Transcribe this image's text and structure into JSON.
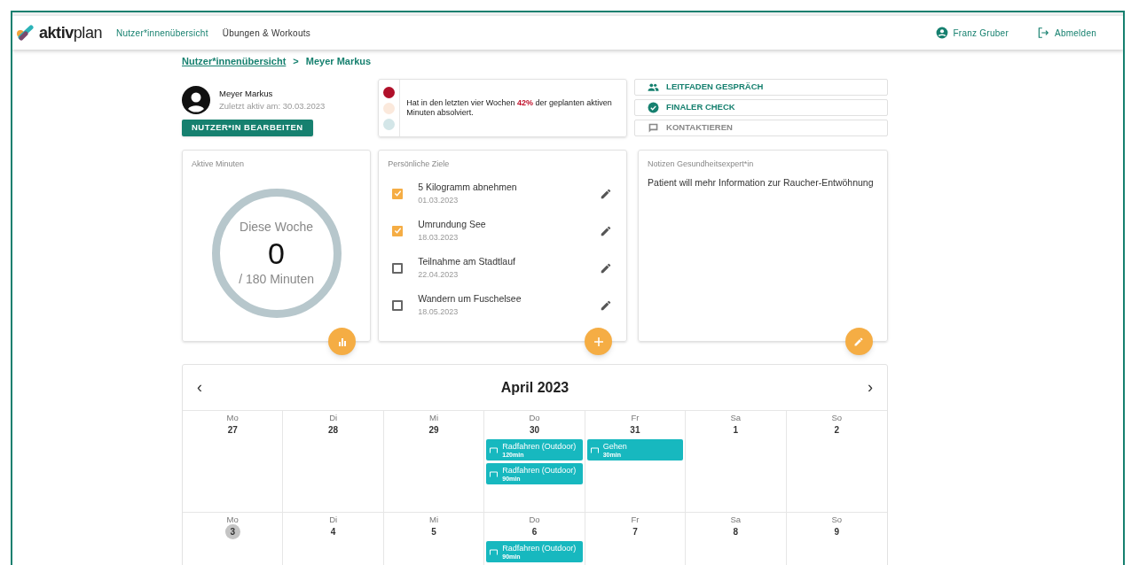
{
  "nav": {
    "logo_bold": "aktiv",
    "logo_rest": "plan",
    "links": [
      {
        "label": "Nutzer*innenübersicht",
        "selected": true
      },
      {
        "label": "Übungen & Workouts",
        "selected": false
      }
    ],
    "user": "Franz Gruber",
    "logout": "Abmelden"
  },
  "breadcrumb": {
    "parent": "Nutzer*innenübersicht",
    "separator": ">",
    "current": "Meyer Markus"
  },
  "profile": {
    "name": "Meyer Markus",
    "last_active": "Zuletzt aktiv am: 30.03.2023",
    "edit_button": "NUTZER*IN BEARBEITEN"
  },
  "status": {
    "lights": [
      {
        "color": "#b0102a"
      },
      {
        "color": "#fbe9dc"
      },
      {
        "color": "#d3e6e8"
      }
    ],
    "text_before": "Hat in den letzten vier Wochen ",
    "highlight": "42%",
    "text_after": " der geplanten aktiven Minuten absolviert."
  },
  "actions": [
    {
      "label": "LEITFADEN GESPRÄCH",
      "kind": "people",
      "disabled": false
    },
    {
      "label": "FINALER CHECK",
      "kind": "check",
      "disabled": false
    },
    {
      "label": "KONTAKTIEREN",
      "kind": "chat",
      "disabled": true
    }
  ],
  "active_minutes": {
    "title": "Aktive Minuten",
    "caption": "Diese Woche",
    "value": "0",
    "goal": "/ 180 Minuten"
  },
  "goals": {
    "title": "Persönliche Ziele",
    "items": [
      {
        "title": "5 Kilogramm abnehmen",
        "date": "01.03.2023",
        "checked": true
      },
      {
        "title": "Umrundung See",
        "date": "18.03.2023",
        "checked": true
      },
      {
        "title": "Teilnahme am Stadtlauf",
        "date": "22.04.2023",
        "checked": false
      },
      {
        "title": "Wandern um Fuschelsee",
        "date": "18.05.2023",
        "checked": false
      }
    ]
  },
  "notes": {
    "title": "Notizen Gesundheitsexpert*in",
    "text": "Patient will mehr Information zur Raucher-Entwöhnung"
  },
  "calendar": {
    "prev": "‹",
    "next": "›",
    "title": "April 2023",
    "weeks": [
      {
        "days": [
          {
            "weekday": "Mo",
            "date": "27",
            "today": false
          },
          {
            "weekday": "Di",
            "date": "28",
            "today": false
          },
          {
            "weekday": "Mi",
            "date": "29",
            "today": false
          },
          {
            "weekday": "Do",
            "date": "30",
            "today": false,
            "events": [
              {
                "title": "Radfahren (Outdoor)",
                "duration": "120min"
              },
              {
                "title": "Radfahren (Outdoor)",
                "duration": "90min"
              }
            ]
          },
          {
            "weekday": "Fr",
            "date": "31",
            "today": false,
            "events": [
              {
                "title": "Gehen",
                "duration": "30min"
              }
            ]
          },
          {
            "weekday": "Sa",
            "date": "1",
            "today": false
          },
          {
            "weekday": "So",
            "date": "2",
            "today": false
          }
        ]
      },
      {
        "days": [
          {
            "weekday": "Mo",
            "date": "3",
            "today": true
          },
          {
            "weekday": "Di",
            "date": "4",
            "today": false
          },
          {
            "weekday": "Mi",
            "date": "5",
            "today": false
          },
          {
            "weekday": "Do",
            "date": "6",
            "today": false,
            "events": [
              {
                "title": "Radfahren (Outdoor)",
                "duration": "90min"
              }
            ]
          },
          {
            "weekday": "Fr",
            "date": "7",
            "today": false
          },
          {
            "weekday": "Sa",
            "date": "8",
            "today": false
          },
          {
            "weekday": "So",
            "date": "9",
            "today": false
          }
        ]
      }
    ]
  }
}
